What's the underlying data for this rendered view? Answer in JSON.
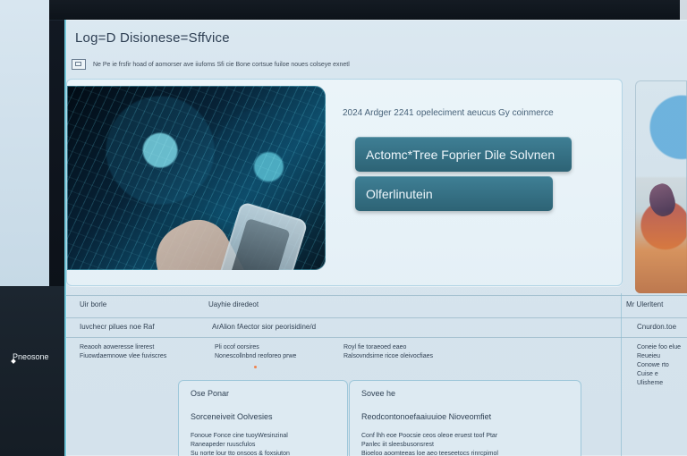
{
  "window": {
    "title": "Log=D Disionese=Sffvice",
    "address": "Ne Pe ie frsfir hoad of aomorser ave iiufoms Sfi cie Bone cortsue fuiloe noues colseye exnetl"
  },
  "hero": {
    "caption": "2024 Ardger 2241 opeleciment aeucus Gy coinmerce",
    "primary_button": "Actomc*Tree  Foprier Dile  Solvnen",
    "secondary_button": "Olferlinutein"
  },
  "rail": {
    "logo_text": "Pneosone"
  },
  "list": {
    "row1_left": "Uir borle",
    "row1_mid": "Uayhie diredeot",
    "row1_right": "Mr Ulerltent",
    "row2_left": "Iuvchecr pilues noe Raf",
    "row2_mid": "ArAlion fAector sior peorisidine/d",
    "row2_right": "Cnurdon.toe",
    "row3_left": "Reaooh aoweresse lirerest\nFiuowdaemnowe vlee fuviscres",
    "row3_mid": "Pli ocof oorsires\nNonescollnbnd reoforeo prwe",
    "row3_center": "Royl fie toraeoed eaeo\nRalsovndsirne ricoe oleivocfiaes",
    "row3_right": "Coneie foo elue\nReueieu\nConowe rto\nCuise e\nUlisheme"
  },
  "cards": {
    "left_title": "Ose Ponar",
    "left_subtitle": "Sorceneiveit Oolvesies",
    "left_body": "Fonoue Fonce cine tuoyWesinzinal\nRaneapeder ruuscfulos\nSu norte lour tto onsoos  & foxsiuton",
    "mid_title": "Sovee he",
    "mid_subtitle": "Reodcontonoefaaiuuioe Nioveomfiet",
    "mid_body": "Conf lhh eoe  Poocsie  ceos oleoe eruest toof Ptar\nPanlec  iit sleesbusonsrest\nBioeloo aoomteeas  loe aeo teeseetocs rinrcpimol"
  }
}
